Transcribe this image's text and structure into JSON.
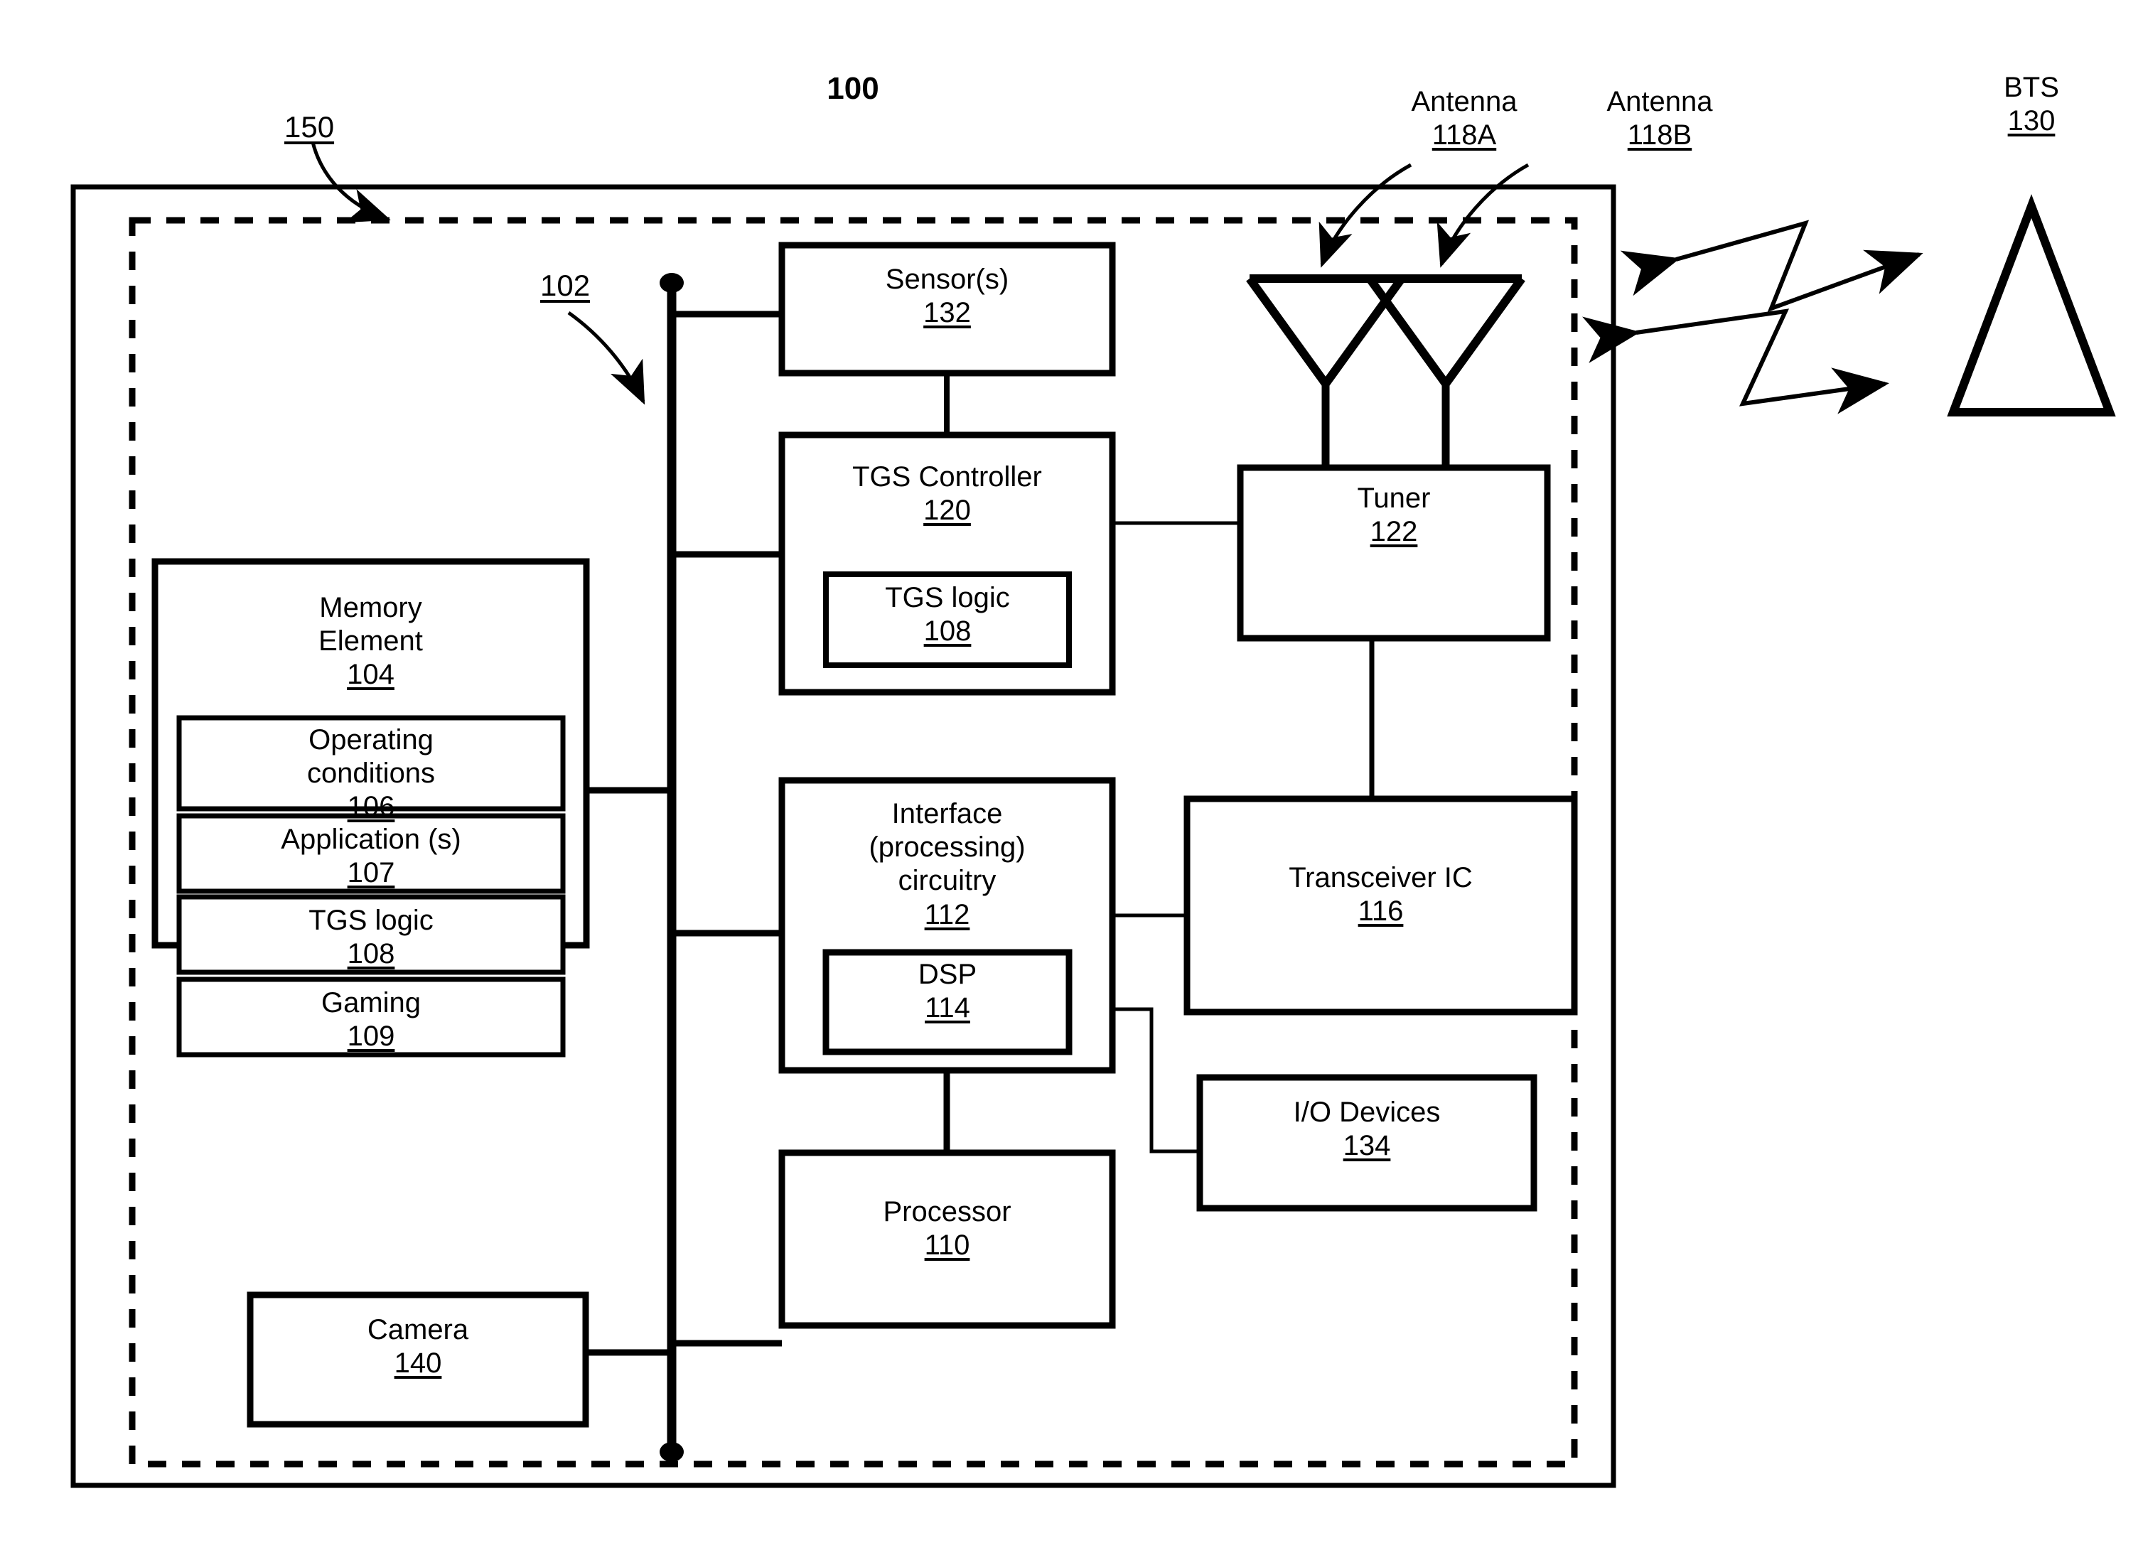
{
  "figure": {
    "figure_number": "100",
    "system_ref": "150",
    "bus_ref": "102"
  },
  "outer_device": {
    "name": "device-boundary",
    "ref": "150"
  },
  "bus": {
    "name": "system-bus",
    "ref": "102"
  },
  "blocks": [
    {
      "id": "sensors",
      "title": "Sensor(s)",
      "ref": "132"
    },
    {
      "id": "tgs_controller",
      "title": "TGS Controller",
      "ref": "120"
    },
    {
      "id": "tgs_logic_ctrl",
      "title": "TGS logic",
      "ref": "108"
    },
    {
      "id": "memory_element",
      "title": "Memory\nElement",
      "ref": "104"
    },
    {
      "id": "operating_cond",
      "title": "Operating\nconditions",
      "ref": "106"
    },
    {
      "id": "applications",
      "title": "Application (s)",
      "ref": "107"
    },
    {
      "id": "tgs_logic_mem",
      "title": "TGS logic",
      "ref": "108"
    },
    {
      "id": "gaming",
      "title": "Gaming",
      "ref": "109"
    },
    {
      "id": "camera",
      "title": "Camera",
      "ref": "140"
    },
    {
      "id": "interface",
      "title": "Interface\n(processing)\ncircuitry",
      "ref": "112"
    },
    {
      "id": "dsp",
      "title": "DSP",
      "ref": "114"
    },
    {
      "id": "processor",
      "title": "Processor",
      "ref": "110"
    },
    {
      "id": "tuner",
      "title": "Tuner",
      "ref": "122"
    },
    {
      "id": "transceiver_ic",
      "title": "Transceiver IC",
      "ref": "116"
    },
    {
      "id": "io_devices",
      "title": "I/O Devices",
      "ref": "134"
    }
  ],
  "labels": {
    "sensors_title": "Sensor(s)",
    "sensors_ref": "132",
    "tgs_controller_title": "TGS Controller",
    "tgs_controller_ref": "120",
    "tgs_logic_ctrl_title": "TGS logic",
    "tgs_logic_ctrl_ref": "108",
    "memory_title_l1": "Memory",
    "memory_title_l2": "Element",
    "memory_ref": "104",
    "operating_title_l1": "Operating",
    "operating_title_l2": "conditions",
    "operating_ref": "106",
    "applications_title": "Application (s)",
    "applications_ref": "107",
    "tgs_logic_mem_title": "TGS logic",
    "tgs_logic_mem_ref": "108",
    "gaming_title": "Gaming",
    "gaming_ref": "109",
    "camera_title": "Camera",
    "camera_ref": "140",
    "interface_title_l1": "Interface",
    "interface_title_l2": "(processing)",
    "interface_title_l3": "circuitry",
    "interface_ref": "112",
    "dsp_title": "DSP",
    "dsp_ref": "114",
    "processor_title": "Processor",
    "processor_ref": "110",
    "tuner_title": "Tuner",
    "tuner_ref": "122",
    "transceiver_title": "Transceiver IC",
    "transceiver_ref": "116",
    "io_devices_title": "I/O Devices",
    "io_devices_ref": "134",
    "antenna_a_title": "Antenna",
    "antenna_a_ref": "118A",
    "antenna_b_title": "Antenna",
    "antenna_b_ref": "118B",
    "bts_title": "BTS",
    "bts_ref": "130",
    "system_ref": "150",
    "bus_ref": "102",
    "figure_number": "100"
  },
  "antennas": [
    {
      "id": "antenna_a",
      "title": "Antenna",
      "ref": "118A"
    },
    {
      "id": "antenna_b",
      "title": "Antenna",
      "ref": "118B"
    }
  ],
  "base_station": {
    "title": "BTS",
    "ref": "130",
    "shape": "triangle-tower"
  },
  "rf_links": [
    {
      "id": "rf-link-upper",
      "style": "lightning-double-arrow"
    },
    {
      "id": "rf-link-lower",
      "style": "lightning-double-arrow"
    }
  ],
  "colors": {
    "stroke": "#000000",
    "background": "#ffffff"
  }
}
